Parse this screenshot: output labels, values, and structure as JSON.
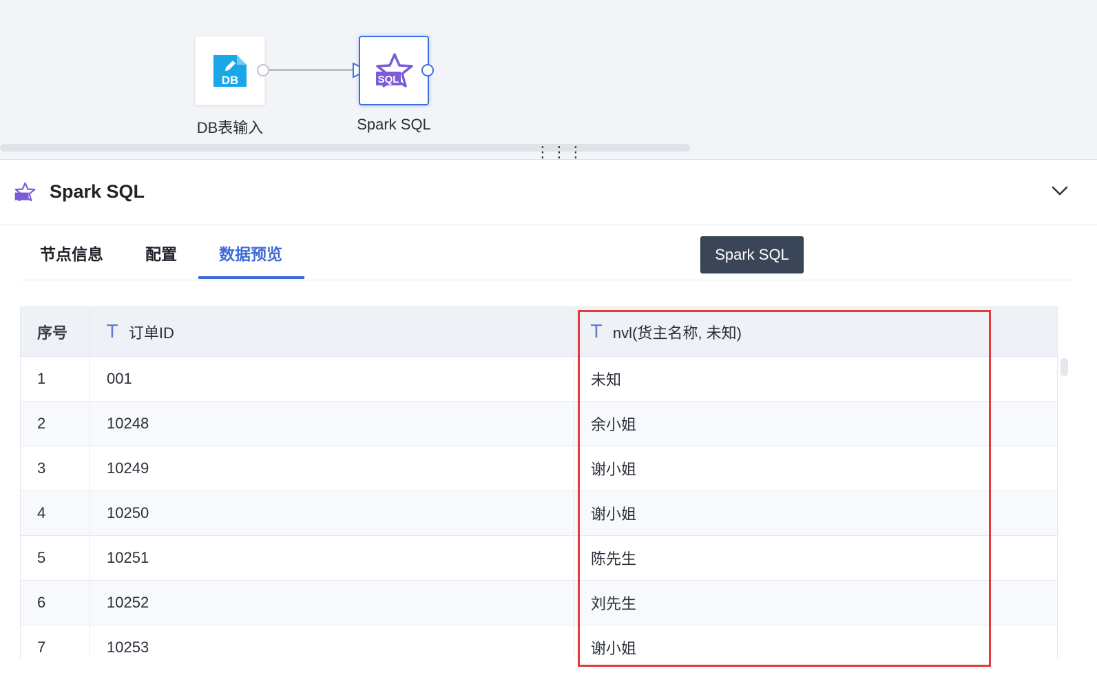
{
  "canvas": {
    "nodes": [
      {
        "id": "db",
        "label": "DB表输入",
        "icon": "db-table-input-icon",
        "icon_text": "DB"
      },
      {
        "id": "sql",
        "label": "Spark SQL",
        "icon": "spark-sql-icon",
        "icon_text": "SQL"
      }
    ],
    "drag_handle": "⋮⋮⋮"
  },
  "panel": {
    "title": "Spark SQL",
    "icon": "spark-sql-icon",
    "collapse_icon": "chevron-down-icon"
  },
  "tabs": [
    {
      "label": "节点信息",
      "active": false
    },
    {
      "label": "配置",
      "active": false
    },
    {
      "label": "数据预览",
      "active": true
    }
  ],
  "tooltip": {
    "text": "Spark SQL"
  },
  "table": {
    "columns": [
      {
        "label": "序号",
        "type_icon": ""
      },
      {
        "label": "订单ID",
        "type_icon": "T"
      },
      {
        "label": "nvl(货主名称, 未知)",
        "type_icon": "T"
      }
    ],
    "rows": [
      [
        "1",
        "001",
        "未知"
      ],
      [
        "2",
        "10248",
        "余小姐"
      ],
      [
        "3",
        "10249",
        "谢小姐"
      ],
      [
        "4",
        "10250",
        "谢小姐"
      ],
      [
        "5",
        "10251",
        "陈先生"
      ],
      [
        "6",
        "10252",
        "刘先生"
      ],
      [
        "7",
        "10253",
        "谢小姐"
      ]
    ]
  },
  "colors": {
    "accent": "#3f6ad8",
    "highlight": "#e63a3a",
    "db_icon": "#1aa7e8",
    "sql_icon": "#7b5cd6"
  }
}
